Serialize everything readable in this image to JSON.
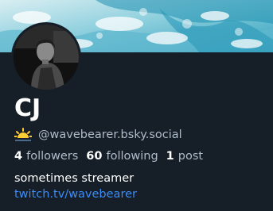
{
  "profile": {
    "display_name": "CJ",
    "handle": "@wavebearer.bsky.social",
    "handle_emoji": "sunrise-icon",
    "stats": {
      "followers_count": "4",
      "followers_label": "followers",
      "following_count": "60",
      "following_label": "following",
      "posts_count": "1",
      "posts_label": "post"
    },
    "bio_text": "sometimes streamer",
    "bio_link": "twitch.tv/wavebearer"
  },
  "colors": {
    "background": "#161e27",
    "link": "#3b8df7",
    "muted_text": "#aebbc9",
    "banner_water": "#3aa9c4"
  }
}
